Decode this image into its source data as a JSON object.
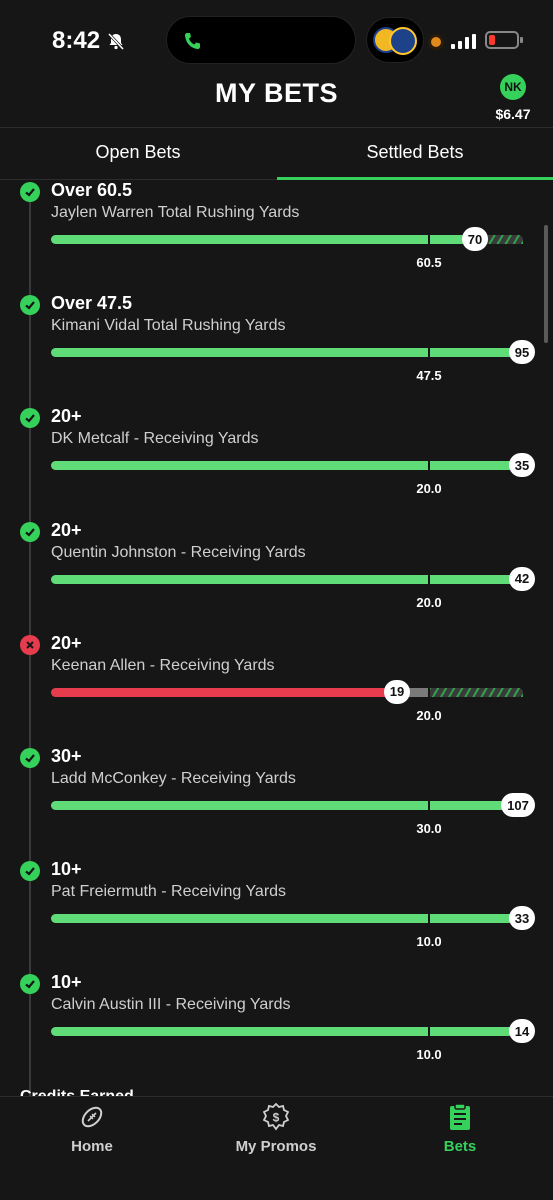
{
  "status_bar": {
    "time": "8:42"
  },
  "header": {
    "title": "MY BETS",
    "avatar_initials": "NK",
    "balance": "$6.47"
  },
  "tabs": [
    {
      "label": "Open Bets",
      "active": false
    },
    {
      "label": "Settled Bets",
      "active": true
    }
  ],
  "bets": [
    {
      "result": "win",
      "line": "Over 60.5",
      "market": "Jaylen Warren Total Rushing Yards",
      "target": "60.5",
      "value": "70",
      "progress": 0.95
    },
    {
      "result": "win",
      "line": "Over 47.5",
      "market": "Kimani Vidal Total Rushing Yards",
      "target": "47.5",
      "value": "95",
      "progress": 1.0
    },
    {
      "result": "win",
      "line": "20+",
      "market": "DK Metcalf - Receiving Yards",
      "target": "20.0",
      "value": "35",
      "progress": 1.0
    },
    {
      "result": "win",
      "line": "20+",
      "market": "Quentin Johnston - Receiving Yards",
      "target": "20.0",
      "value": "42",
      "progress": 1.0
    },
    {
      "result": "loss",
      "line": "20+",
      "market": "Keenan Allen - Receiving Yards",
      "target": "20.0",
      "value": "19",
      "progress": 0.95
    },
    {
      "result": "win",
      "line": "30+",
      "market": "Ladd McConkey - Receiving Yards",
      "target": "30.0",
      "value": "107",
      "progress": 1.0
    },
    {
      "result": "win",
      "line": "10+",
      "market": "Pat Freiermuth - Receiving Yards",
      "target": "10.0",
      "value": "33",
      "progress": 1.0
    },
    {
      "result": "win",
      "line": "10+",
      "market": "Calvin Austin III - Receiving Yards",
      "target": "10.0",
      "value": "14",
      "progress": 1.0
    }
  ],
  "footer_peek": "Credits Earned",
  "bottom_nav": [
    {
      "label": "Home",
      "icon": "football-icon",
      "active": false
    },
    {
      "label": "My Promos",
      "icon": "dollar-badge-icon",
      "active": false
    },
    {
      "label": "Bets",
      "icon": "clipboard-icon",
      "active": true
    }
  ],
  "colors": {
    "accent": "#35d15a",
    "win": "#5fdb78",
    "loss": "#e63c4e",
    "background": "#161616"
  }
}
